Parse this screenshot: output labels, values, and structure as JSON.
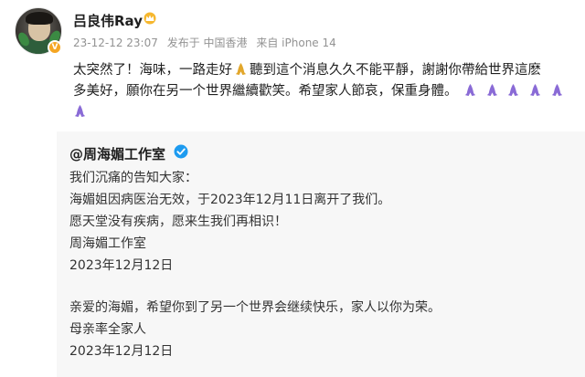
{
  "post": {
    "username": "吕良伟Ray",
    "date": "23-12-12 23:07",
    "published_from": "发布于 中国香港",
    "device": "来自 iPhone 14",
    "text_part1": "太突然了！海味，一路走好",
    "text_part2": "聽到這个消息久久不能平靜，謝謝你帶給世界這麽",
    "text_line2": "多美好，願你在另一个世界繼續歡笑。希望家人節哀，保重身體。",
    "icons": {
      "avatar": "user-avatar",
      "verified": "verified-badge-icon",
      "crown": "crown-icon",
      "pray": "praying-hands-emoji"
    }
  },
  "repost": {
    "author": "@周海媚工作室",
    "lines": [
      "我们沉痛的告知大家：",
      "海媚姐因病医治无效，于2023年12月11日离开了我们。",
      "愿天堂没有疾病，愿来生我们再相识！",
      "周海媚工作室",
      "2023年12月12日",
      "亲爱的海媚，希望你到了另一个世界会继续快乐，家人以你为荣。",
      "母亲率全家人",
      "2023年12月12日"
    ]
  },
  "colors": {
    "repost_bg": "#f7f7f7",
    "meta_text": "#939393",
    "verify_blue": "#1d9bf0",
    "verify_orange": "#f5a623",
    "emoji_purple": "#8a6bd6"
  }
}
